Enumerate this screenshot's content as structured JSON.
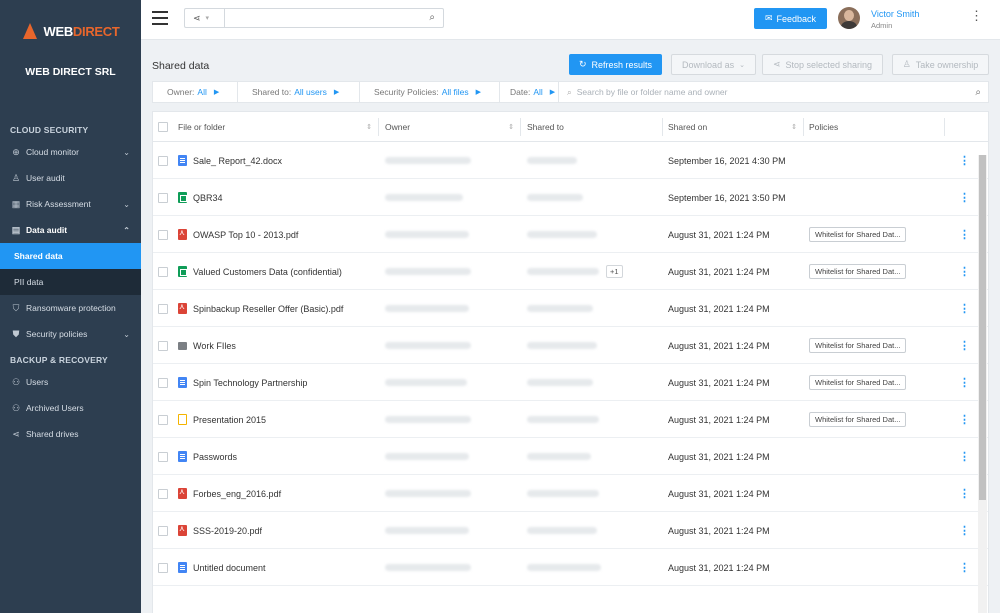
{
  "sidebar": {
    "logo_web": "WEB",
    "logo_direct": "DIRECT",
    "company": "WEB DIRECT SRL",
    "sections": {
      "cloud_security": "CLOUD SECURITY",
      "backup_recovery": "BACKUP & RECOVERY"
    },
    "items": {
      "cloud_monitor": "Cloud monitor",
      "user_audit": "User audit",
      "risk_assessment": "Risk Assessment",
      "data_audit": "Data audit",
      "shared_data": "Shared data",
      "pii_data": "PII data",
      "ransomware": "Ransomware protection",
      "security_policies": "Security policies",
      "users": "Users",
      "archived_users": "Archived Users",
      "shared_drives": "Shared drives"
    }
  },
  "topbar": {
    "feedback": "Feedback",
    "user_name": "Victor Smith",
    "user_role": "Admin"
  },
  "toolbar": {
    "title": "Shared data",
    "refresh": "Refresh results",
    "download": "Download as",
    "stop_sharing": "Stop selected sharing",
    "take_ownership": "Take ownership"
  },
  "filters": {
    "owner_label": "Owner:",
    "owner_value": "All",
    "shared_to_label": "Shared to:",
    "shared_to_value": "All users",
    "policies_label": "Security Policies:",
    "policies_value": "All files",
    "date_label": "Date:",
    "date_value": "All",
    "search_placeholder": "Search by file or folder name and owner"
  },
  "table": {
    "columns": {
      "file": "File or folder",
      "owner": "Owner",
      "shared_to": "Shared to",
      "shared_on": "Shared on",
      "policies": "Policies"
    },
    "rows": [
      {
        "name": "Sale_ Report_42.docx",
        "type": "doc",
        "shared_on": "September 16, 2021 4:30 PM",
        "policy": "",
        "extra": ""
      },
      {
        "name": "QBR34",
        "type": "sheet",
        "shared_on": "September 16, 2021 3:50 PM",
        "policy": "",
        "extra": ""
      },
      {
        "name": "OWASP Top 10 - 2013.pdf",
        "type": "pdf",
        "shared_on": "August 31, 2021 1:24 PM",
        "policy": "Whitelist for Shared Dat...",
        "extra": ""
      },
      {
        "name": "Valued Customers Data (confidential)",
        "type": "sheet",
        "shared_on": "August 31, 2021 1:24 PM",
        "policy": "Whitelist for Shared Dat...",
        "extra": "+1"
      },
      {
        "name": "Spinbackup Reseller Offer (Basic).pdf",
        "type": "pdf",
        "shared_on": "August 31, 2021 1:24 PM",
        "policy": "",
        "extra": ""
      },
      {
        "name": "Work FIles",
        "type": "folder",
        "shared_on": "August 31, 2021 1:24 PM",
        "policy": "Whitelist for Shared Dat...",
        "extra": ""
      },
      {
        "name": "Spin Technology Partnership",
        "type": "doc",
        "shared_on": "August 31, 2021 1:24 PM",
        "policy": "Whitelist for Shared Dat...",
        "extra": ""
      },
      {
        "name": "Presentation 2015",
        "type": "slides",
        "shared_on": "August 31, 2021 1:24 PM",
        "policy": "Whitelist for Shared Dat...",
        "extra": ""
      },
      {
        "name": "Passwords",
        "type": "doc",
        "shared_on": "August 31, 2021 1:24 PM",
        "policy": "",
        "extra": ""
      },
      {
        "name": "Forbes_eng_2016.pdf",
        "type": "pdf",
        "shared_on": "August 31, 2021 1:24 PM",
        "policy": "",
        "extra": ""
      },
      {
        "name": "SSS-2019-20.pdf",
        "type": "pdf",
        "shared_on": "August 31, 2021 1:24 PM",
        "policy": "",
        "extra": ""
      },
      {
        "name": "Untitled document",
        "type": "doc",
        "shared_on": "August 31, 2021 1:24 PM",
        "policy": "",
        "extra": ""
      }
    ]
  }
}
